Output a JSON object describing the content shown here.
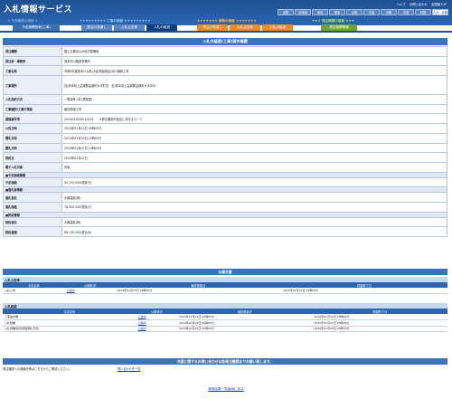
{
  "app": {
    "title": "入札情報サービス"
  },
  "toplinks": [
    "ヘルプ",
    "お問い合わせ",
    "全国版TOP"
  ],
  "regions": [
    "全国",
    "北海道",
    "東北",
    "関東",
    "北陸",
    "中部",
    "近畿",
    "中国",
    "四国",
    "九州・沖縄"
  ],
  "categories": {
    "schedule": "★ 予定機関の検索 ★",
    "construction": "★★★★★★★★★ 工事の検索 ★★★★★★★★★",
    "business": "★★★★★★★ 業務の検索 ★★★★★★★",
    "issuer": "★★★ 発注機関の検索 ★★★"
  },
  "tabs": [
    "予定機関検索(工事)",
    "発注の見通し",
    "入札公告等",
    "入札の経過",
    "発注の見通し",
    "入札公告等",
    "入札の経過",
    "発注機関情報"
  ],
  "detail": {
    "panel_title": "入札の経過(工事)案件概要",
    "rows": [
      {
        "label": "発注機関",
        "value": "国土交通省九州地方整備局"
      },
      {
        "label": "発注部・事務所",
        "value": "熊本河川国道事務所"
      },
      {
        "label": "工事名称",
        "value": "令和6年度熊本川水系(大臣単独地区)河川補修工事"
      },
      {
        "label": "工事場所",
        "value": "自)熊本県上益城郡益城町大字杉堂　至)熊本県上益城郡益城町大字寺中"
      },
      {
        "label": "入札契約方式",
        "value": "一般競争入札(標準型)"
      },
      {
        "label": "工事種別/工事の等級",
        "value": "維持修繕工事"
      },
      {
        "label": "調達番号等",
        "value": "2024003030010019　　★発注機関が独自に決めるコード"
      },
      {
        "label": "公告日時",
        "value": "2024年01月20日 09時00分"
      },
      {
        "label": "開札日時",
        "value": "2024年01月30日 10時00分"
      },
      {
        "label": "開札日時",
        "value": "2024年02月07日 10時00分"
      },
      {
        "label": "契約日",
        "value": "2024年02月22日"
      },
      {
        "label": "電子入札対象",
        "value": "対象"
      }
    ],
    "section_budget": "■予定価格情報",
    "budget_label": "予定価格",
    "budget_value": "90,120,000(税抜き)",
    "section_award": "■落札者情報",
    "award_name_label": "落札者名",
    "award_name_value": "大翼建設(株)",
    "award_price_label": "落札価格",
    "award_price_value": "78,300,000(税抜き)",
    "section_contract": "■契約情報",
    "contractor_label": "契約者名",
    "contractor_value": "大翼建設(株)",
    "contract_amount_label": "契約金額",
    "contract_amount_value": "86,130,000(税込み)"
  },
  "documents": {
    "title": "公開文書",
    "section1": "入札公告等",
    "section2": "入札経過",
    "headers": [
      "文書名称",
      "公開状況",
      "最終更新日",
      "掲載終了日"
    ],
    "group1": [
      {
        "name": "入札公告",
        "status": "公開中",
        "updated": "2024年01月23日 09時00分",
        "end": "2025年01月31日 23時59分"
      }
    ],
    "group2": [
      {
        "name": "工事設計書",
        "status": "公開中",
        "updated": "2024年01月23日 09時00分",
        "end": "2025年01月31日 23時59分"
      },
      {
        "name": "入札調書",
        "status": "公開中",
        "updated": "2024年02月14日 09時00分",
        "end": "2025年01月31日 23時59分"
      },
      {
        "name": "入札調書(総合評価落札方式)",
        "status": "公開中",
        "updated": "2024年02月14日 09時00分",
        "end": "2025年01月31日 23時59分"
      }
    ]
  },
  "contact": {
    "title": "内容に関するお問い合わせは各発注機関までお願い致します。",
    "text": "発注機関への連絡先等はこちらからご確認ください。",
    "link": "問い合わせ先一覧"
  },
  "back_link": "検索結果一覧画面に戻る",
  "colors": {
    "header": "#1e4f92",
    "panel": "#3a73c0",
    "orange": "#f08a1e",
    "green": "#6fa336",
    "blue_tab": "#2b66b3"
  }
}
